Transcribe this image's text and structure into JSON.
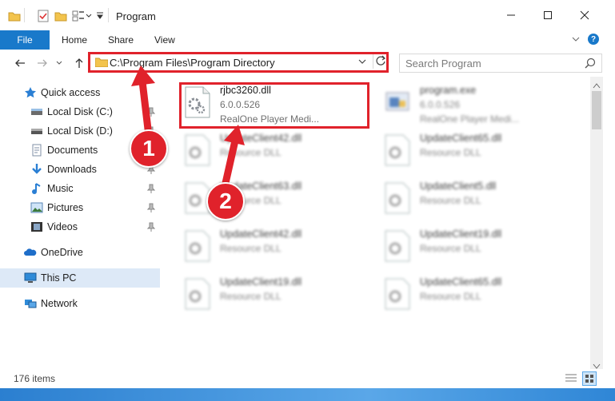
{
  "window": {
    "title": "Program",
    "controls": {
      "minimize": "—",
      "maximize": "☐",
      "close": "✕"
    }
  },
  "ribbon": {
    "tabs": [
      {
        "label": "File"
      },
      {
        "label": "Home"
      },
      {
        "label": "Share"
      },
      {
        "label": "View"
      }
    ],
    "help": "?"
  },
  "address": {
    "path": "C:\\Program Files\\Program Directory",
    "search_placeholder": "Search Program"
  },
  "nav": {
    "items": [
      {
        "label": "Quick access",
        "icon": "star-icon"
      },
      {
        "label": "Local Disk (C:)",
        "icon": "drive-icon"
      },
      {
        "label": "Local Disk (D:)",
        "icon": "drive-icon"
      },
      {
        "label": "Documents",
        "icon": "documents-icon"
      },
      {
        "label": "Downloads",
        "icon": "downloads-icon"
      },
      {
        "label": "Music",
        "icon": "music-icon"
      },
      {
        "label": "Pictures",
        "icon": "pictures-icon"
      },
      {
        "label": "Videos",
        "icon": "videos-icon"
      },
      {
        "label": "OneDrive",
        "icon": "cloud-icon"
      },
      {
        "label": "This PC",
        "icon": "computer-icon"
      },
      {
        "label": "Network",
        "icon": "network-icon"
      }
    ]
  },
  "files": [
    {
      "name": "rjbc3260.dll",
      "line1": "6.0.0.526",
      "line2": "RealOne Player Medi..."
    },
    {
      "name": "program.exe",
      "line1": "6.0.0.526",
      "line2": "RealOne Player Medi..."
    },
    {
      "name": "UpdateClient42.dll",
      "line1": "Resource DLL"
    },
    {
      "name": "UpdateClient65.dll",
      "line1": "Resource DLL"
    },
    {
      "name": "UpdateClient63.dll",
      "line1": "Resource DLL"
    },
    {
      "name": "UpdateClient5.dll",
      "line1": "Resource DLL"
    },
    {
      "name": "UpdateClient42.dll",
      "line1": "Resource DLL"
    },
    {
      "name": "UpdateClient19.dll",
      "line1": "Resource DLL"
    },
    {
      "name": "UpdateClient19.dll",
      "line1": "Resource DLL"
    },
    {
      "name": "UpdateClient65.dll",
      "line1": "Resource DLL"
    }
  ],
  "status": {
    "items_count": "176 items"
  },
  "callouts": {
    "step1": "1",
    "step2": "2"
  },
  "colors": {
    "accent": "#1979ca",
    "highlight": "#e0222b",
    "selected": "#dde9f7"
  }
}
